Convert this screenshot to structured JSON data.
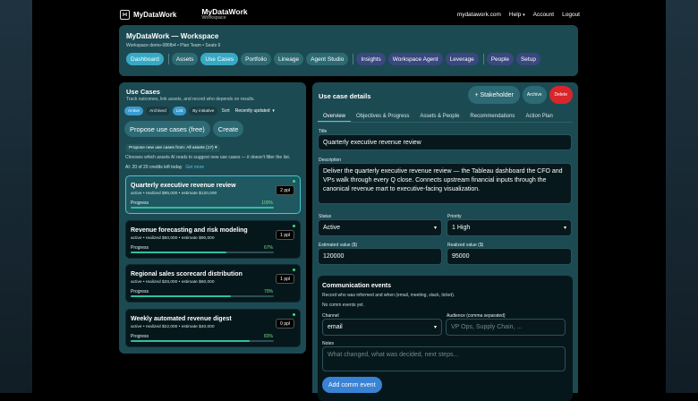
{
  "brand": "MyDataWork",
  "workspace": {
    "title": "MyDataWork",
    "subtitle": "Workspace"
  },
  "topnav": {
    "site": "mydatawork.com",
    "help": "Help",
    "help_chevron": "▾",
    "account": "Account",
    "logout": "Logout"
  },
  "header": {
    "title": "MyDataWork — Workspace",
    "meta": "Workspace demo-086fb4 • Plan Team • Seats 6",
    "nav_primary": [
      "Dashboard",
      "Assets",
      "Use Cases",
      "Portfolio",
      "Lineage",
      "Agent Studio"
    ],
    "nav_secondary": [
      "Insights",
      "Workspace Agent",
      "Leverage"
    ],
    "nav_tertiary": [
      "People",
      "Setup"
    ],
    "active": "Use Cases"
  },
  "left": {
    "title": "Use Cases",
    "subtitle": "Track outcomes, link assets, and record who depends on results.",
    "filters": [
      "Active",
      "Archived",
      "List",
      "By initiative"
    ],
    "sort_label": "Sort",
    "sort_value": "Recently updated",
    "sort_chevron": "▾",
    "propose_btn": "Propose use cases (free)",
    "create_btn": "Create",
    "propose_select": "Propose new use cases from: All assets (17)",
    "propose_chevron": "▾",
    "hint": "Chooses which assets AI reads to suggest new use cases — it doesn't filter the list.",
    "credits": "AI: 20 of 20 credits left today",
    "credits_link": "Get more",
    "use_cases": [
      {
        "title": "Quarterly executive revenue review",
        "meta": "active • realized $95,000 • estimate $120,000",
        "progress_label": "Progress",
        "pct": "100%",
        "progress": 1.0,
        "ppl": "2 ppl",
        "selected": true
      },
      {
        "title": "Revenue forecasting and risk modeling",
        "meta": "active • realized $50,000 • estimate $90,000",
        "progress_label": "Progress",
        "pct": "67%",
        "progress": 0.67,
        "ppl": "1 ppl",
        "selected": false
      },
      {
        "title": "Regional sales scorecard distribution",
        "meta": "active • realized $28,000 • estimate $60,000",
        "progress_label": "Progress",
        "pct": "70%",
        "progress": 0.7,
        "ppl": "1 ppl",
        "selected": false
      },
      {
        "title": "Weekly automated revenue digest",
        "meta": "active • realized $22,000 • estimate $40,000",
        "progress_label": "Progress",
        "pct": "83%",
        "progress": 0.83,
        "ppl": "0 ppl",
        "selected": false
      }
    ]
  },
  "right": {
    "title": "Use case details",
    "stakeholder_btn": "+ Stakeholder",
    "archive_btn": "Archive",
    "delete_btn": "Delete",
    "tabs": [
      "Overview",
      "Objectives & Progress",
      "Assets & People",
      "Recommendations",
      "Action Plan"
    ],
    "active_tab": "Overview",
    "title_label": "Title",
    "title_value": "Quarterly executive revenue review",
    "desc_label": "Description",
    "desc_value": "Deliver the quarterly executive revenue review — the Tableau dashboard the CFO and VPs walk through every Q close. Connects upstream financial inputs through the canonical revenue mart to executive-facing visualization.",
    "status_label": "Status",
    "status_value": "Active",
    "priority_label": "Priority",
    "priority_value": "1 High",
    "select_chevron": "▾",
    "est_label": "Estimated value ($)",
    "est_value": "120000",
    "real_label": "Realized value ($)",
    "real_value": "95000",
    "comm": {
      "title": "Communication events",
      "desc": "Record who was informed and when (email, meeting, slack, ticket).",
      "empty": "No comm events yet.",
      "channel_label": "Channel",
      "channel_value": "email",
      "audience_label": "Audience (comma separated)",
      "audience_placeholder": "VP Ops, Supply Chain, ...",
      "notes_label": "Notes",
      "notes_placeholder": "What changed, what was decided, next steps...",
      "add_btn": "Add comm event"
    }
  },
  "colors": {
    "accent": "#38a9c4",
    "panel": "#1c4a52",
    "danger": "#d8262c",
    "success": "#35e07a"
  }
}
